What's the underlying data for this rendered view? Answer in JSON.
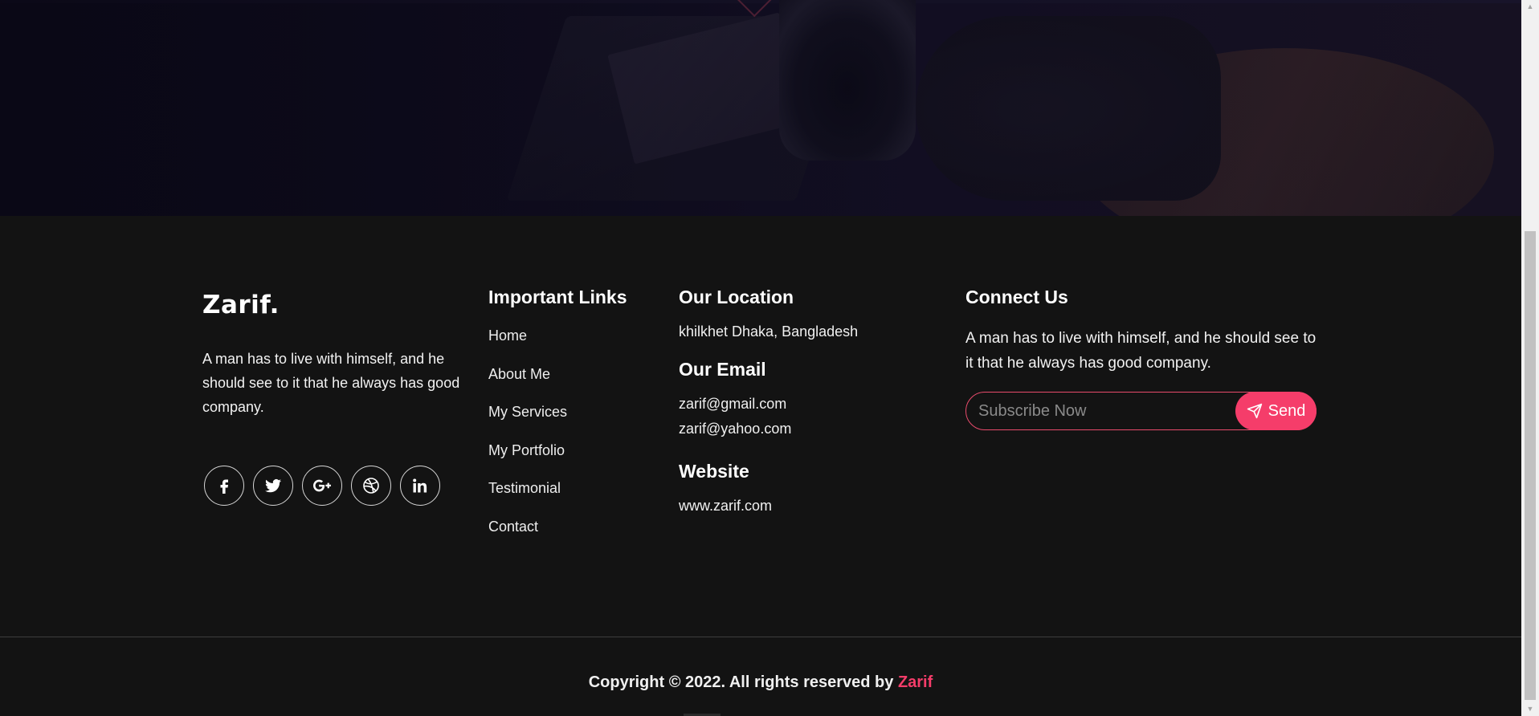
{
  "footer": {
    "brand": {
      "name": "Zarif.",
      "description": "A man has to live with himself, and he should see to it that he always has good company.",
      "socials": [
        {
          "icon": "facebook-icon"
        },
        {
          "icon": "twitter-icon"
        },
        {
          "icon": "google-plus-icon"
        },
        {
          "icon": "dribbble-icon"
        },
        {
          "icon": "linkedin-icon"
        }
      ]
    },
    "links": {
      "heading": "Important Links",
      "items": [
        "Home",
        "About Me",
        "My Services",
        "My Portfolio",
        "Testimonial",
        "Contact"
      ]
    },
    "location": {
      "heading": "Our Location",
      "address": "khilkhet Dhaka, Bangladesh",
      "email_heading": "Our Email",
      "emails": [
        "zarif@gmail.com",
        "zarif@yahoo.com"
      ],
      "website_heading": "Website",
      "website": "www.zarif.com"
    },
    "connect": {
      "heading": "Connect Us",
      "description": "A man has to live with himself, and he should see to it that he always has good company.",
      "subscribe_placeholder": "Subscribe Now",
      "subscribe_value": "",
      "send_label": "Send"
    },
    "copyright": {
      "text": "Copyright © 2022. All rights reserved by ",
      "owner": "Zarif"
    }
  },
  "colors": {
    "accent": "#f53d6a",
    "background": "#131313",
    "text": "#ffffff"
  }
}
